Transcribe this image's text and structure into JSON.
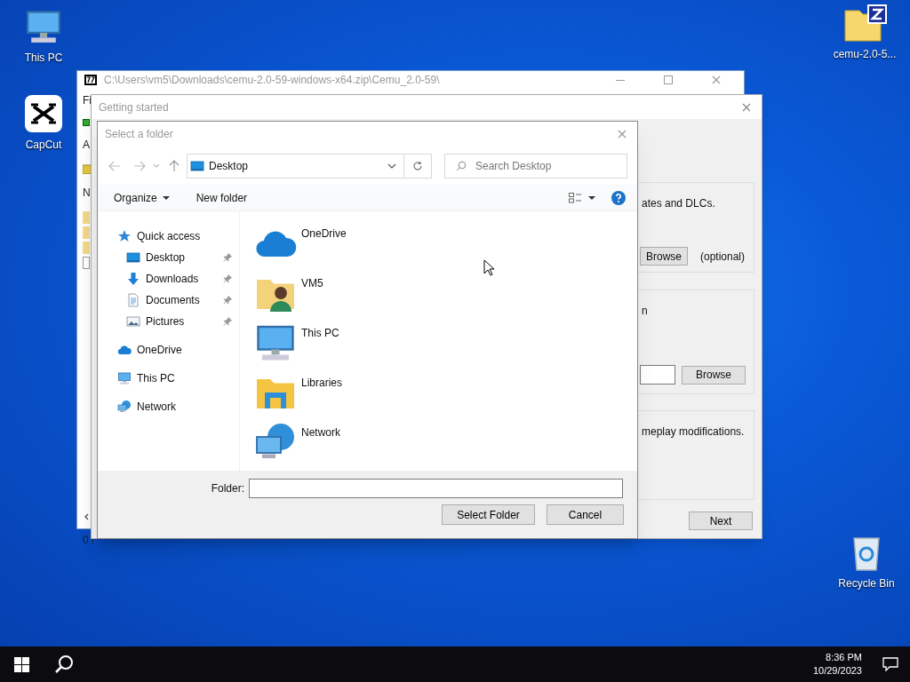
{
  "desktop_icons": [
    {
      "label": "This PC",
      "kind": "pc"
    },
    {
      "label": "CapCut",
      "kind": "capcut"
    },
    {
      "label": "cemu-2.0-5...",
      "kind": "zip"
    },
    {
      "label": "Recycle Bin",
      "kind": "bin"
    }
  ],
  "archive_window": {
    "title": "C:\\Users\\vm5\\Downloads\\cemu-2.0-59-windows-x64.zip\\Cemu_2.0-59\\",
    "fragments": [
      "Fi",
      "A",
      "N"
    ],
    "status": "0 /"
  },
  "setup_window": {
    "title": "Getting started",
    "groups": [
      {
        "text": "ates and DLCs.",
        "button": "Browse",
        "note": "(optional)"
      },
      {
        "text": "n",
        "button": "Browse",
        "field": true
      },
      {
        "text": "meplay modifications."
      }
    ],
    "next": "Next"
  },
  "folder_dialog": {
    "title": "Select a folder",
    "location": "Desktop",
    "search_placeholder": "Search Desktop",
    "toolbar": [
      "Organize",
      "New folder"
    ],
    "nav": [
      {
        "label": "Quick access",
        "kind": "star",
        "children": [
          {
            "label": "Desktop",
            "kind": "desktop",
            "pinned": true
          },
          {
            "label": "Downloads",
            "kind": "download",
            "pinned": true
          },
          {
            "label": "Documents",
            "kind": "document",
            "pinned": true
          },
          {
            "label": "Pictures",
            "kind": "pictures",
            "pinned": true
          }
        ]
      },
      {
        "label": "OneDrive",
        "kind": "cloud"
      },
      {
        "label": "This PC",
        "kind": "pc"
      },
      {
        "label": "Network",
        "kind": "network"
      }
    ],
    "items": [
      {
        "label": "OneDrive",
        "kind": "cloud"
      },
      {
        "label": "VM5",
        "kind": "user"
      },
      {
        "label": "This PC",
        "kind": "pc"
      },
      {
        "label": "Libraries",
        "kind": "libraries"
      },
      {
        "label": "Network",
        "kind": "network"
      }
    ],
    "folder_label": "Folder:",
    "buttons": [
      "Select Folder",
      "Cancel"
    ]
  },
  "taskbar": {
    "time": "8:36 PM",
    "date": "10/29/2023"
  }
}
